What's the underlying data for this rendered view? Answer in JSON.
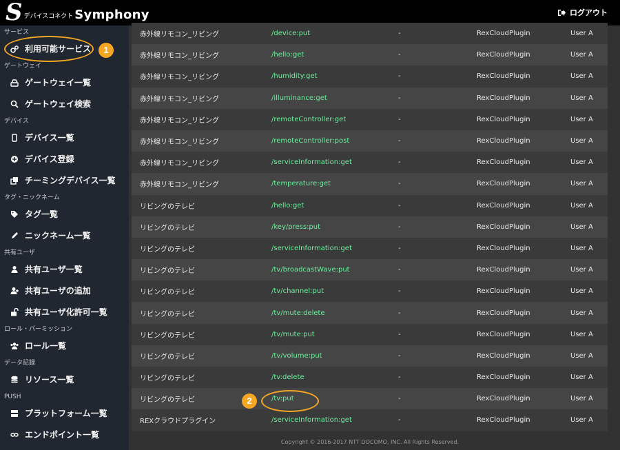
{
  "header": {
    "logo_mark": "S",
    "logo_sub": "デバイスコネクト",
    "logo_main": "Symphony",
    "logout_label": "ログアウト"
  },
  "sidebar": {
    "sections": [
      {
        "title": "サービス",
        "items": [
          {
            "label": "利用可能サービス",
            "icon": "cogs-icon"
          }
        ]
      },
      {
        "title": "ゲートウェイ",
        "items": [
          {
            "label": "ゲートウェイ一覧",
            "icon": "hdd-icon"
          },
          {
            "label": "ゲートウェイ検索",
            "icon": "search-icon"
          }
        ]
      },
      {
        "title": "デバイス",
        "items": [
          {
            "label": "デバイス一覧",
            "icon": "mobile-icon"
          },
          {
            "label": "デバイス登録",
            "icon": "plus-circle-icon"
          },
          {
            "label": "チーミングデバイス一覧",
            "icon": "clone-icon"
          }
        ]
      },
      {
        "title": "タグ・ニックネーム",
        "items": [
          {
            "label": "タグ一覧",
            "icon": "tags-icon"
          },
          {
            "label": "ニックネーム一覧",
            "icon": "pencil-icon"
          }
        ]
      },
      {
        "title": "共有ユーザ",
        "items": [
          {
            "label": "共有ユーザ一覧",
            "icon": "user-icon"
          },
          {
            "label": "共有ユーザの追加",
            "icon": "user-plus-icon"
          },
          {
            "label": "共有ユーザ化許可一覧",
            "icon": "unlock-icon"
          }
        ]
      },
      {
        "title": "ロール・パーミッション",
        "items": [
          {
            "label": "ロール一覧",
            "icon": "users-icon"
          }
        ]
      },
      {
        "title": "データ記録",
        "items": [
          {
            "label": "リソース一覧",
            "icon": "database-icon"
          }
        ]
      },
      {
        "title": "PUSH",
        "items": [
          {
            "label": "プラットフォーム一覧",
            "icon": "server-icon"
          },
          {
            "label": "エンドポイント一覧",
            "icon": "link-icon"
          }
        ]
      }
    ]
  },
  "table": {
    "rows": [
      {
        "device": "赤外線リモコン_リビング",
        "api": "/device:put",
        "dash": "-",
        "plugin": "RexCloudPlugin",
        "user": "User A"
      },
      {
        "device": "赤外線リモコン_リビング",
        "api": "/hello:get",
        "dash": "-",
        "plugin": "RexCloudPlugin",
        "user": "User A"
      },
      {
        "device": "赤外線リモコン_リビング",
        "api": "/humidity:get",
        "dash": "-",
        "plugin": "RexCloudPlugin",
        "user": "User A"
      },
      {
        "device": "赤外線リモコン_リビング",
        "api": "/illuminance:get",
        "dash": "-",
        "plugin": "RexCloudPlugin",
        "user": "User A"
      },
      {
        "device": "赤外線リモコン_リビング",
        "api": "/remoteController:get",
        "dash": "-",
        "plugin": "RexCloudPlugin",
        "user": "User A"
      },
      {
        "device": "赤外線リモコン_リビング",
        "api": "/remoteController:post",
        "dash": "-",
        "plugin": "RexCloudPlugin",
        "user": "User A"
      },
      {
        "device": "赤外線リモコン_リビング",
        "api": "/serviceInformation:get",
        "dash": "-",
        "plugin": "RexCloudPlugin",
        "user": "User A"
      },
      {
        "device": "赤外線リモコン_リビング",
        "api": "/temperature:get",
        "dash": "-",
        "plugin": "RexCloudPlugin",
        "user": "User A"
      },
      {
        "device": "リビングのテレビ",
        "api": "/hello:get",
        "dash": "-",
        "plugin": "RexCloudPlugin",
        "user": "User A"
      },
      {
        "device": "リビングのテレビ",
        "api": "/key/press:put",
        "dash": "-",
        "plugin": "RexCloudPlugin",
        "user": "User A"
      },
      {
        "device": "リビングのテレビ",
        "api": "/serviceInformation:get",
        "dash": "-",
        "plugin": "RexCloudPlugin",
        "user": "User A"
      },
      {
        "device": "リビングのテレビ",
        "api": "/tv/broadcastWave:put",
        "dash": "-",
        "plugin": "RexCloudPlugin",
        "user": "User A"
      },
      {
        "device": "リビングのテレビ",
        "api": "/tv/channel:put",
        "dash": "-",
        "plugin": "RexCloudPlugin",
        "user": "User A"
      },
      {
        "device": "リビングのテレビ",
        "api": "/tv/mute:delete",
        "dash": "-",
        "plugin": "RexCloudPlugin",
        "user": "User A"
      },
      {
        "device": "リビングのテレビ",
        "api": "/tv/mute:put",
        "dash": "-",
        "plugin": "RexCloudPlugin",
        "user": "User A"
      },
      {
        "device": "リビングのテレビ",
        "api": "/tv/volume:put",
        "dash": "-",
        "plugin": "RexCloudPlugin",
        "user": "User A"
      },
      {
        "device": "リビングのテレビ",
        "api": "/tv:delete",
        "dash": "-",
        "plugin": "RexCloudPlugin",
        "user": "User A"
      },
      {
        "device": "リビングのテレビ",
        "api": "/tv:put",
        "dash": "-",
        "plugin": "RexCloudPlugin",
        "user": "User A"
      },
      {
        "device": "REXクラウドプラグイン",
        "api": "/serviceInformation:get",
        "dash": "-",
        "plugin": "RexCloudPlugin",
        "user": "User A"
      }
    ]
  },
  "footer": {
    "copyright": "Copyright © 2016-2017 NTT DOCOMO, INC. All Rights Reserved."
  },
  "annotations": {
    "badge1": "1",
    "badge2": "2",
    "color": "#f5a623"
  }
}
